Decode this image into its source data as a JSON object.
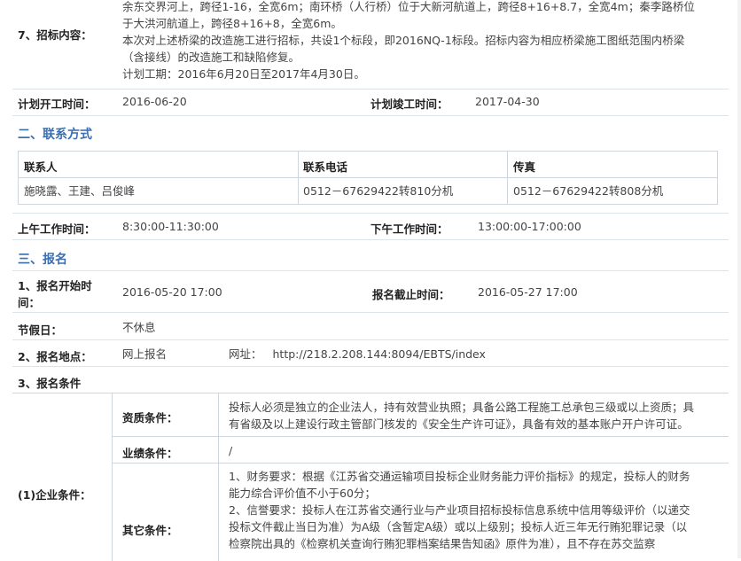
{
  "item7": {
    "label": "7、招标内容：",
    "lines": [
      "余东交界河上，跨径1-16，全宽6m；南环桥（人行桥）位于大新河航道上，跨径8+16+8.7，全宽4m；秦李路桥位",
      "于大洪河航道上，跨径8+16+8，全宽6m。",
      "本次对上述桥梁的改造施工进行招标，共设1个标段，即2016NQ-1标段。招标内容为相应桥梁施工图纸范围内桥梁",
      "（含接线）的改造施工和缺陷修复。",
      "计划工期：2016年6月20日至2017年4月30日。"
    ]
  },
  "plan": {
    "start_label": "计划开工时间：",
    "start_value": "2016-06-20",
    "end_label": "计划竣工时间：",
    "end_value": "2017-04-30"
  },
  "contact_section": "二、联系方式",
  "contact_table": {
    "headers": [
      "联系人",
      "联系电话",
      "传真"
    ],
    "row": [
      "施晓露、王建、吕俊峰",
      "0512－67629422转810分机",
      "0512－67629422转808分机"
    ]
  },
  "work_hours": {
    "am_label": "上午工作时间：",
    "am_value": "8:30:00-11:30:00",
    "pm_label": "下午工作时间：",
    "pm_value": "13:00:00-17:00:00"
  },
  "signup_section": "三、报名",
  "signup": {
    "start_label_1": "1、报名开始时",
    "start_label_2": "间：",
    "start_value": "2016-05-20 17:00",
    "end_label": "报名截止时间：",
    "end_value": "2016-05-27 17:00",
    "holiday_label": "节假日：",
    "holiday_value": "不休息",
    "place_label": "2、报名地点：",
    "place_value": "网上报名",
    "url_label": "网址：",
    "url_value": "http://218.2.208.144:8094/EBTS/index",
    "cond_label": "3、报名条件"
  },
  "conditions": {
    "company_label": "(1)企业条件：",
    "qual_label": "资质条件：",
    "qual_lines": [
      "投标人必须是独立的企业法人，持有效营业执照；具备公路工程施工总承包三级或以上资质；具",
      "有省级及以上建设行政主管部门核发的《安全生产许可证》，具备有效的基本账户开户许可证。"
    ],
    "perf_label": "业绩条件：",
    "perf_value": "/",
    "other_label": "其它条件：",
    "other_lines": [
      "1、财务要求：根据《江苏省交通运输项目投标企业财务能力评价指标》的规定，投标人的财务",
      "能力综合评价值不小于60分；",
      "2、信誉要求：投标人在江苏省交通行业与产业项目招标投标信息系统中信用等级评价（以递交",
      "投标文件截止当日为准）为A级（含暂定A级）或以上级别；投标人近三年无行贿犯罪记录（以",
      "检察院出具的《检察机关查询行贿犯罪档案结果告知函》原件为准），且不存在苏交监察"
    ]
  }
}
